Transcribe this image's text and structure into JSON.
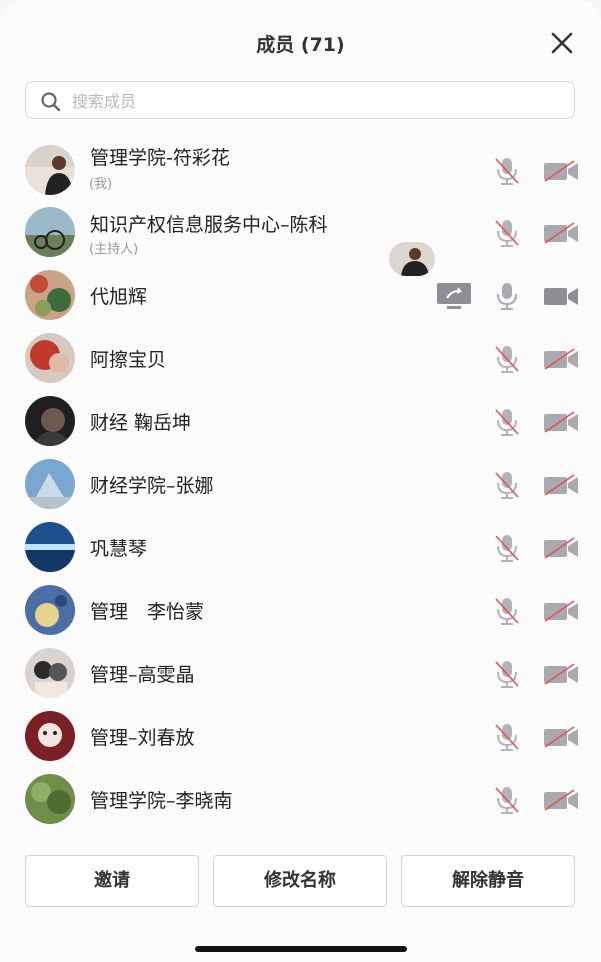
{
  "header": {
    "title": "成员 (71)"
  },
  "search": {
    "placeholder": "搜索成员"
  },
  "members": [
    {
      "name": "管理学院-符彩花",
      "tag": "(我)",
      "mic": "muted",
      "camera": "off"
    },
    {
      "name": "知识产权信息服务中心–陈科",
      "tag": "(主持人)",
      "mic": "muted",
      "camera": "off"
    },
    {
      "name": "代旭辉",
      "tag": "",
      "mic": "on",
      "camera": "on",
      "screen_share": true
    },
    {
      "name": "阿擦宝贝",
      "tag": "",
      "mic": "muted",
      "camera": "off"
    },
    {
      "name": "财经 鞠岳坤",
      "tag": "",
      "mic": "muted",
      "camera": "off"
    },
    {
      "name": "财经学院–张娜",
      "tag": "",
      "mic": "muted",
      "camera": "off"
    },
    {
      "name": "巩慧琴",
      "tag": "",
      "mic": "muted",
      "camera": "off"
    },
    {
      "name": "管理　李怡蒙",
      "tag": "",
      "mic": "muted",
      "camera": "off"
    },
    {
      "name": "管理–高雯晶",
      "tag": "",
      "mic": "muted",
      "camera": "off"
    },
    {
      "name": "管理–刘春放",
      "tag": "",
      "mic": "muted",
      "camera": "off"
    },
    {
      "name": "管理学院–李晓南",
      "tag": "",
      "mic": "muted",
      "camera": "off"
    }
  ],
  "footer": {
    "invite": "邀请",
    "rename": "修改名称",
    "unmute": "解除静音"
  },
  "colors": {
    "muted_red": "#e05555",
    "icon_gray": "#a9a9ae",
    "text": "#222222"
  },
  "icons": {
    "close": "close-icon",
    "search": "search-icon",
    "mic_muted": "mic-muted-icon",
    "mic_on": "mic-icon",
    "camera_off": "camera-off-icon",
    "camera_on": "camera-icon",
    "screen_share": "screen-share-icon"
  }
}
